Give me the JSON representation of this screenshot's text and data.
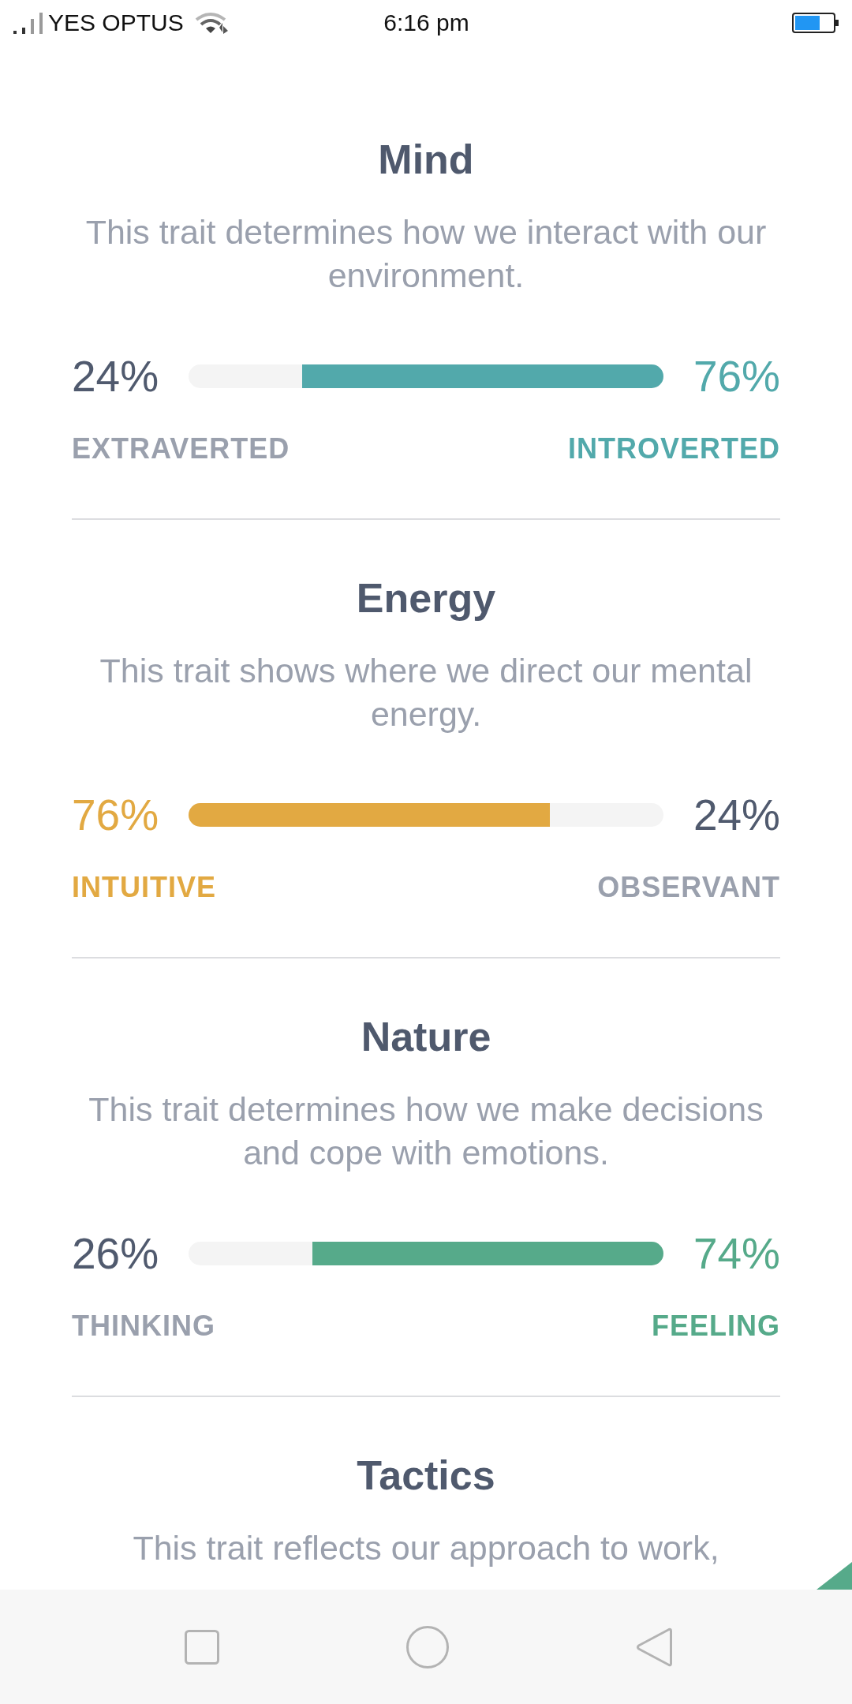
{
  "status_bar": {
    "carrier": "YES OPTUS",
    "time": "6:16 pm"
  },
  "sections": [
    {
      "title": "Mind",
      "description": "This trait determines how we interact with our environment.",
      "scale": {
        "left": {
          "percent": "24%",
          "label": "EXTRAVERTED",
          "highlighted": false
        },
        "right": {
          "percent": "76%",
          "label": "INTROVERTED",
          "highlighted": true
        },
        "level": 0.76,
        "color": "#52a9ab"
      }
    },
    {
      "title": "Energy",
      "description": "This trait shows where we direct our mental energy.",
      "scale": {
        "left": {
          "percent": "76%",
          "label": "INTUITIVE",
          "highlighted": true
        },
        "right": {
          "percent": "24%",
          "label": "OBSERVANT",
          "highlighted": false
        },
        "level": 0.76,
        "color": "#e2a942"
      }
    },
    {
      "title": "Nature",
      "description": "This trait determines how we make decisions and cope with emotions.",
      "scale": {
        "left": {
          "percent": "26%",
          "label": "THINKING",
          "highlighted": false
        },
        "right": {
          "percent": "74%",
          "label": "FEELING",
          "highlighted": true
        },
        "level": 0.74,
        "color": "#56aa8a"
      }
    },
    {
      "title": "Tactics",
      "description": "This trait reflects our approach to work,"
    }
  ]
}
